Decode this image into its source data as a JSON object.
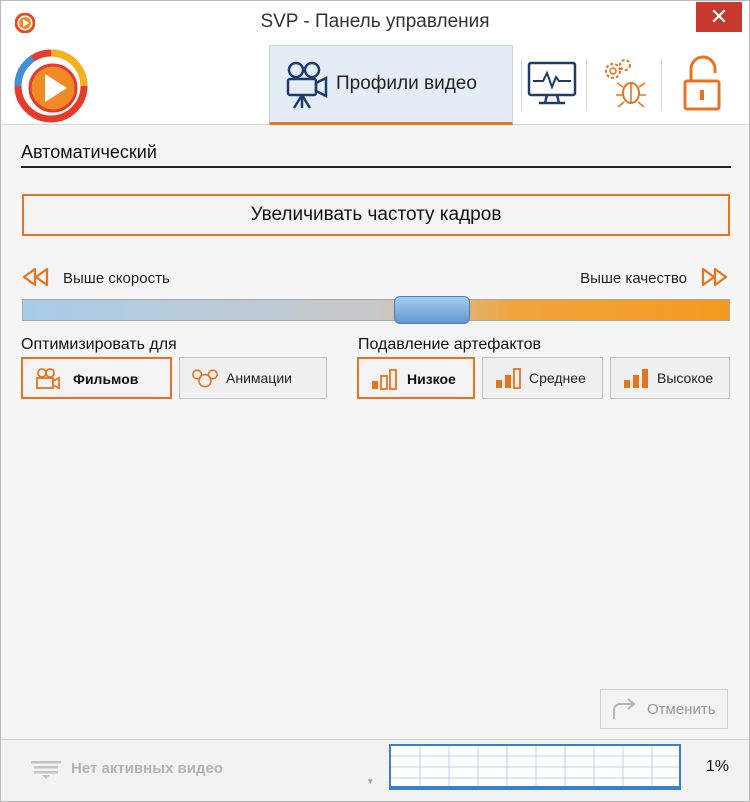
{
  "window": {
    "title": "SVP - Панель управления",
    "close_glyph": "✕"
  },
  "toolbar": {
    "tabs": [
      {
        "label": "Профили видео",
        "icon": "video-camera-icon",
        "active": true
      },
      {
        "label": "",
        "icon": "monitor-pulse-icon"
      },
      {
        "label": "",
        "icon": "gears-bug-icon"
      },
      {
        "label": "",
        "icon": "unlocked-padlock-icon"
      }
    ]
  },
  "profile": {
    "name": "Автоматический",
    "main_button": "Увеличивать частоту кадров",
    "speed_label": "Выше скорость",
    "quality_label": "Выше качество",
    "slider_value": 0.58
  },
  "optimize": {
    "title": "Оптимизировать для",
    "options": [
      {
        "label": "Фильмов",
        "icon": "film-camera-icon",
        "selected": true
      },
      {
        "label": "Анимации",
        "icon": "mouse-ears-icon",
        "selected": false
      }
    ]
  },
  "artifacts": {
    "title": "Подавление артефактов",
    "options": [
      {
        "label": "Низкое",
        "icon": "bars-icon",
        "selected": true
      },
      {
        "label": "Среднее",
        "icon": "bars-icon",
        "selected": false
      },
      {
        "label": "Высокое",
        "icon": "bars-icon",
        "selected": false
      }
    ]
  },
  "cancel": {
    "label": "Отменить"
  },
  "status": {
    "no_video": "Нет активных видео",
    "dropdown_glyph": "▾",
    "cpu_percent": "1%"
  },
  "colors": {
    "accent": "#e8731e",
    "close": "#c7392e",
    "graph_border": "#3b7fd0"
  }
}
